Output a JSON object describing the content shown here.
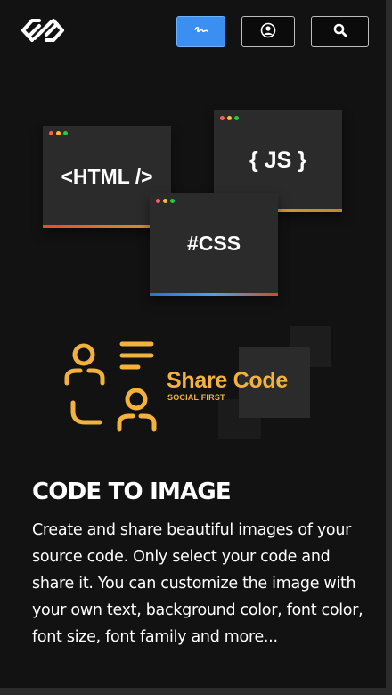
{
  "colors": {
    "background": "#121212",
    "accent_blue": "#3a8ff1",
    "accent_gold": "#f2b23c",
    "window_bg": "#2b2b2b"
  },
  "header": {
    "logo_icon": "chain-link-logo",
    "buttons": [
      {
        "icon": "signature-icon"
      },
      {
        "icon": "user-circle-icon"
      },
      {
        "icon": "search-icon"
      }
    ]
  },
  "hero": {
    "windows": [
      {
        "label": "<HTML />"
      },
      {
        "label": "{ JS }"
      },
      {
        "label": "#CSS"
      }
    ],
    "share": {
      "title": "Share Code",
      "subtitle": "SOCIAL FIRST",
      "icon": "people-share-icon"
    }
  },
  "content": {
    "title": "CODE TO IMAGE",
    "description": "Create and share beautiful images of your source code. Only select your code and share it. You can customize the image with your own text, background color, font color, font size, font family and more..."
  }
}
